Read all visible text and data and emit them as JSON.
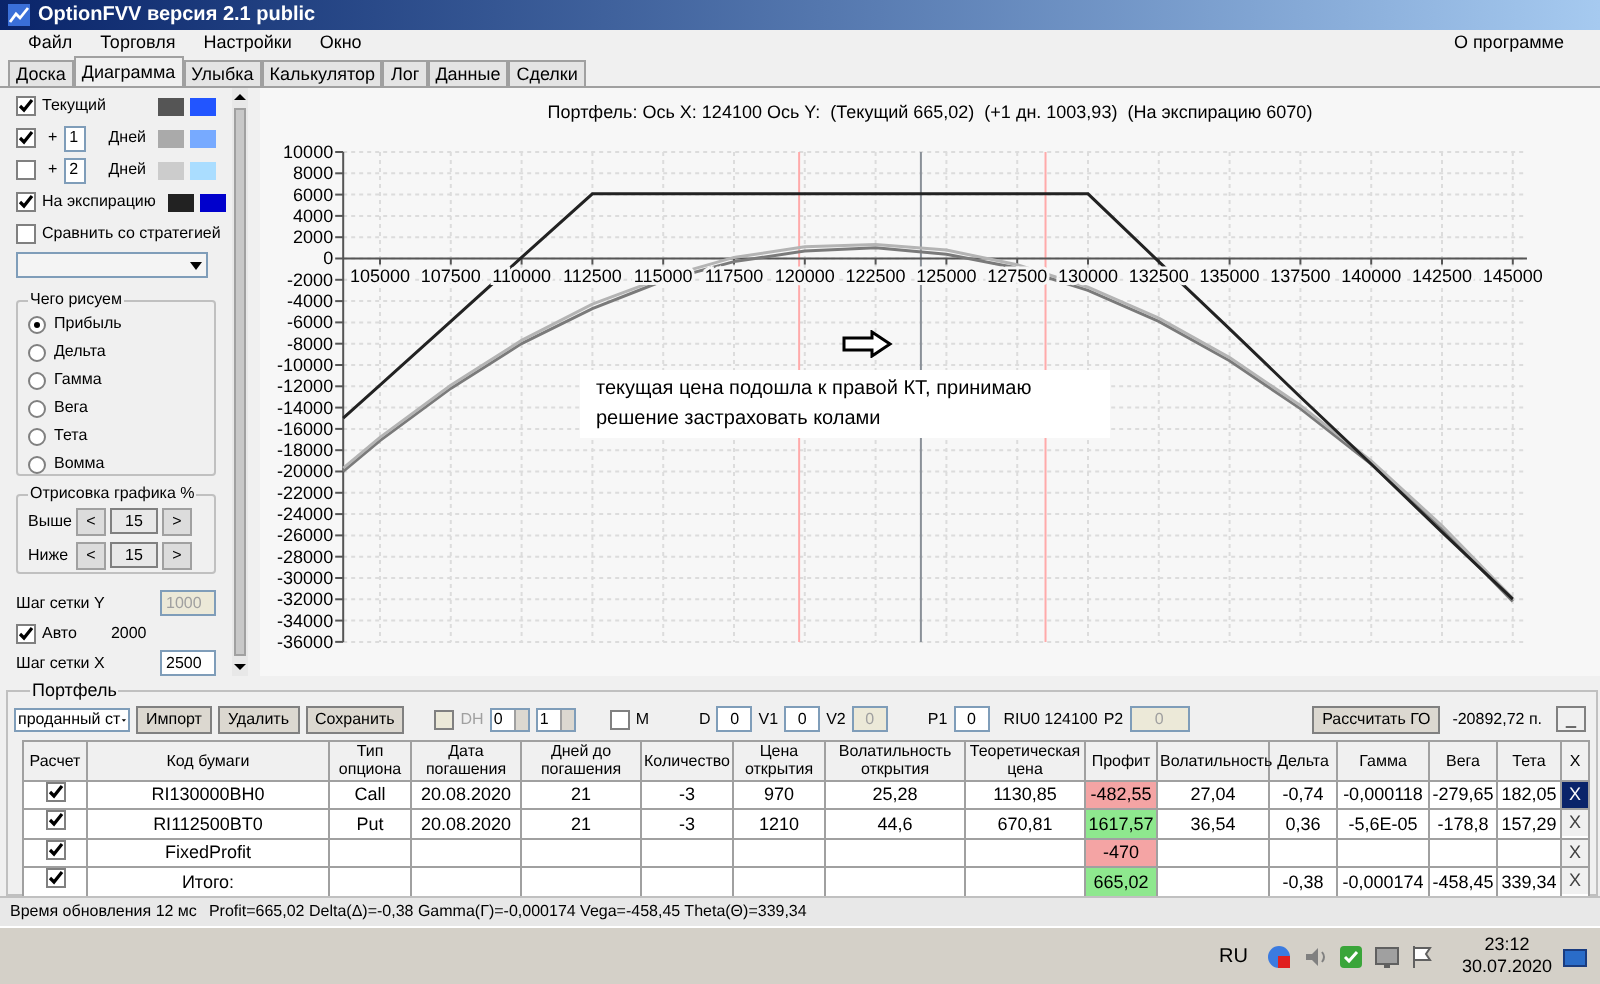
{
  "window": {
    "title": "OptionFVV версия 2.1 public"
  },
  "menu": [
    {
      "label": "Файл"
    },
    {
      "label": "Торговля"
    },
    {
      "label": "Настройки"
    },
    {
      "label": "Окно"
    }
  ],
  "menu_right": {
    "label": "О программе"
  },
  "tabs": [
    {
      "label": "Доска",
      "selected": false
    },
    {
      "label": "Диаграмма",
      "selected": true
    },
    {
      "label": "Улыбка",
      "selected": false
    },
    {
      "label": "Калькулятор",
      "selected": false
    },
    {
      "label": "Лог",
      "selected": false
    },
    {
      "label": "Данные",
      "selected": false
    },
    {
      "label": "Сделки",
      "selected": false
    }
  ],
  "sidebar": {
    "series_rows": [
      {
        "kind": "plain",
        "checked": true,
        "label": "Текущий",
        "swatches": [
          {
            "color": "#555555"
          },
          {
            "color": "#2255ff"
          }
        ]
      },
      {
        "kind": "days",
        "checked": true,
        "sign": "+",
        "days": "1",
        "unit": "Дней",
        "swatches": [
          {
            "color": "#aaaaaa"
          },
          {
            "color": "#77aaff"
          }
        ]
      },
      {
        "kind": "days",
        "checked": false,
        "sign": "+",
        "days": "2",
        "unit": "Дней",
        "swatches": [
          {
            "color": "#cccccc"
          },
          {
            "color": "#aaddff"
          }
        ]
      },
      {
        "kind": "plain",
        "checked": true,
        "label": "На экспирацию",
        "swatches": [
          {
            "color": "#222222"
          },
          {
            "color": "#0000cc"
          }
        ]
      }
    ],
    "compare": {
      "label": "Сравнить со стратегией",
      "checked": false
    },
    "draw_group": {
      "title": "Чего рисуем",
      "options": [
        {
          "label": "Прибыль",
          "selected": true
        },
        {
          "label": "Дельта",
          "selected": false
        },
        {
          "label": "Гамма",
          "selected": false
        },
        {
          "label": "Вега",
          "selected": false
        },
        {
          "label": "Тета",
          "selected": false
        },
        {
          "label": "Вомма",
          "selected": false
        }
      ]
    },
    "range_group": {
      "title": "Отрисовка графика %",
      "rows": [
        {
          "label": "Выше",
          "dec": "<",
          "value": "15",
          "inc": ">"
        },
        {
          "label": "Ниже",
          "dec": "<",
          "value": "15",
          "inc": ">"
        }
      ]
    },
    "grid": {
      "y_label": "Шаг сетки Y",
      "y_value": "1000",
      "auto": {
        "label": "Авто",
        "checked": true,
        "value": "2000"
      },
      "x_label": "Шаг сетки X",
      "x_value": "2500"
    }
  },
  "chart": {
    "title": "Портфель: Ось X: 124100 Ось Y:  (Текущий 665,02)  (+1 дн. 1003,93)  (На экспирацию 6070)",
    "chart_data": {
      "type": "line",
      "x": [
        103700,
        105000,
        107500,
        110000,
        112500,
        115000,
        117500,
        120000,
        122500,
        125000,
        127500,
        130000,
        132500,
        135000,
        137500,
        140000,
        142500,
        145000
      ],
      "series": [
        {
          "color": "#7a7a7a",
          "values": [
            -20000,
            -17100,
            -12200,
            -8000,
            -4700,
            -2100,
            -300,
            700,
            1000,
            400,
            -900,
            -3000,
            -5900,
            -9600,
            -14100,
            -19300,
            -25400,
            -32200
          ]
        },
        {
          "color": "#b4b4b4",
          "values": [
            -19700,
            -16800,
            -11900,
            -7700,
            -4300,
            -1800,
            100,
            1100,
            1300,
            800,
            -600,
            -2700,
            -5600,
            -9300,
            -13800,
            -19000,
            -25100,
            -31900
          ]
        },
        {
          "color": "#222222",
          "values": [
            -15000,
            -11900,
            -5900,
            100,
            6070,
            6070,
            6070,
            6070,
            6070,
            6070,
            6070,
            6070,
            -300,
            -6600,
            -13000,
            -19300,
            -25700,
            -32000
          ]
        }
      ],
      "xlim": [
        103700,
        145500
      ],
      "ylim": [
        -36000,
        10000
      ],
      "xticks": [
        105000,
        107500,
        110000,
        112500,
        115000,
        117500,
        120000,
        122500,
        125000,
        127500,
        130000,
        132500,
        135000,
        137500,
        140000,
        142500,
        145000
      ],
      "yticks": [
        10000,
        8000,
        6000,
        4000,
        2000,
        0,
        -2000,
        -4000,
        -6000,
        -8000,
        -10000,
        -12000,
        -14000,
        -16000,
        -18000,
        -20000,
        -22000,
        -24000,
        -26000,
        -28000,
        -30000,
        -32000,
        -34000,
        -36000
      ],
      "grid": true,
      "ref_lines": [
        {
          "axis": "x",
          "value": 119800,
          "color": "#ffaaaa"
        },
        {
          "axis": "x",
          "value": 128500,
          "color": "#ffaaaa"
        },
        {
          "axis": "x",
          "value": 124100,
          "color": "#8a9098"
        }
      ]
    },
    "note": {
      "text": "текущая цена подошла к правой КТ, принимаю решение застраховать колами"
    }
  },
  "portfolio": {
    "title": "Портфель",
    "strategy": "проданный ст",
    "buttons": [
      {
        "label": "Импорт"
      },
      {
        "label": "Удалить"
      },
      {
        "label": "Сохранить"
      }
    ],
    "dh": {
      "label": "DH",
      "checked": false,
      "disabled": true
    },
    "spinners": [
      "0",
      "1"
    ],
    "m": {
      "label": "M",
      "checked": false
    },
    "fields": [
      {
        "label": "D",
        "value": "0",
        "disabled": false
      },
      {
        "label": "V1",
        "value": "0",
        "disabled": false
      },
      {
        "label": "V2",
        "value": "0",
        "disabled": true
      },
      {
        "label": "P1",
        "value": "0",
        "disabled": false
      }
    ],
    "underlying": "RIU0 124100",
    "p2": {
      "label": "P2",
      "value": "0",
      "disabled": true
    },
    "margin_button": "Рассчитать ГО",
    "margin_value": "-20892,72 п.",
    "minimize_button": "_",
    "table": {
      "columns": [
        "Расчет",
        "Код бумаги",
        "Тип опциона",
        "Дата погашения",
        "Дней до погашения",
        "Количество",
        "Цена открытия",
        "Волатильность открытия",
        "Теоретическая цена",
        "Профит",
        "Волатильность",
        "Дельта",
        "Гамма",
        "Вега",
        "Тета",
        "X"
      ],
      "rows": [
        {
          "checked": true,
          "selected": true,
          "color": "#f4a4a4",
          "cells": [
            "",
            "RI130000BH0",
            "Call",
            "20.08.2020",
            "21",
            "-3",
            "970",
            "25,28",
            "1130,85",
            "-482,55",
            "27,04",
            "-0,74",
            "-0,000118",
            "-279,65",
            "182,05"
          ],
          "remove": "X"
        },
        {
          "checked": true,
          "selected": false,
          "color": "#8ee88e",
          "cells": [
            "",
            "RI112500BT0",
            "Put",
            "20.08.2020",
            "21",
            "-3",
            "1210",
            "44,6",
            "670,81",
            "1617,57",
            "36,54",
            "0,36",
            "-5,6E-05",
            "-178,8",
            "157,29"
          ],
          "remove": "X"
        },
        {
          "checked": true,
          "selected": false,
          "color": "#f4a4a4",
          "cells": [
            "",
            "FixedProfit",
            null,
            null,
            null,
            null,
            null,
            null,
            null,
            "-470",
            null,
            null,
            null,
            null,
            null
          ],
          "remove": "X"
        },
        {
          "checked": true,
          "selected": false,
          "color": "#8ee88e",
          "cells": [
            "",
            "Итого:",
            null,
            null,
            null,
            null,
            null,
            null,
            null,
            "665,02",
            null,
            "-0,38",
            "-0,000174",
            "-458,45",
            "339,34"
          ],
          "remove": "X"
        }
      ]
    }
  },
  "status_bar": {
    "update": "Время обновления 12 мс",
    "greeks": "Profit=665,02 Delta(Δ)=-0,38 Gamma(Γ)=-0,000174 Vega=-458,45 Theta(Θ)=339,34"
  },
  "taskbar": {
    "language": "RU",
    "time": "23:12",
    "date": "30.07.2020"
  }
}
